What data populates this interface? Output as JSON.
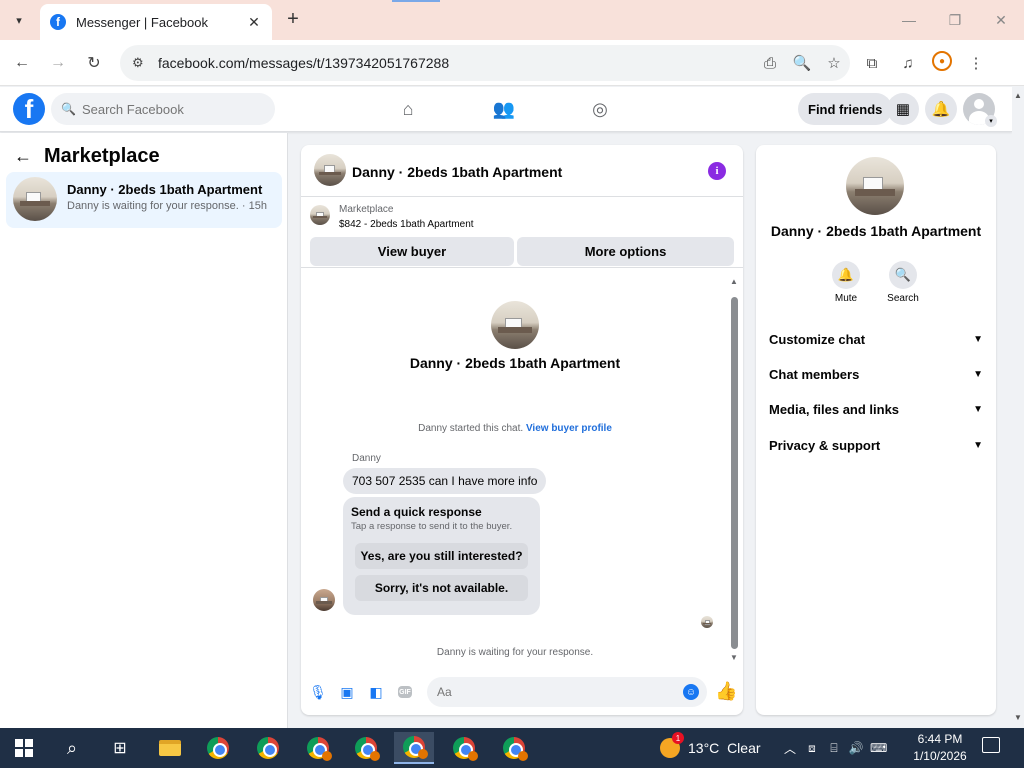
{
  "browser": {
    "tab_title": "Messenger | Facebook",
    "tab_close": "✕",
    "new_tab": "+",
    "url": "facebook.com/messages/t/1397342051767288"
  },
  "fb": {
    "search_placeholder": "Search Facebook",
    "find_friends": "Find friends",
    "brand_color": "#1877f2"
  },
  "left": {
    "title": "Marketplace",
    "conversation": {
      "name": "Danny · 2beds 1bath Apartment",
      "subtitle": "Danny is waiting for your response. · 15h"
    }
  },
  "chat": {
    "header_name": "Danny · 2beds 1bath Apartment",
    "marketplace_label": "Marketplace",
    "marketplace_item": "$842 - 2beds 1bath Apartment",
    "view_buyer": "View buyer",
    "more_options": "More options",
    "profile_name": "Danny · 2beds 1bath Apartment",
    "started_text": "Danny started this chat.",
    "view_buyer_profile": "View buyer profile",
    "sender": "Danny",
    "message": "703 507 2535 can I have more info",
    "quick_title": "Send a quick response",
    "quick_sub": "Tap a response to send it to the buyer.",
    "quick_1": "Yes, are you still interested?",
    "quick_2": "Sorry, it's not available.",
    "waiting": "Danny is waiting for your response.",
    "composer_placeholder": "Aa"
  },
  "right": {
    "name": "Danny · 2beds 1bath Apartment",
    "mute": "Mute",
    "search": "Search",
    "sections": [
      "Customize chat",
      "Chat members",
      "Media, files and links",
      "Privacy & support"
    ]
  },
  "taskbar": {
    "temperature": "13°C",
    "condition": "Clear",
    "weather_badge": "1",
    "time": "6:44 PM",
    "date": "1/10/2026"
  }
}
